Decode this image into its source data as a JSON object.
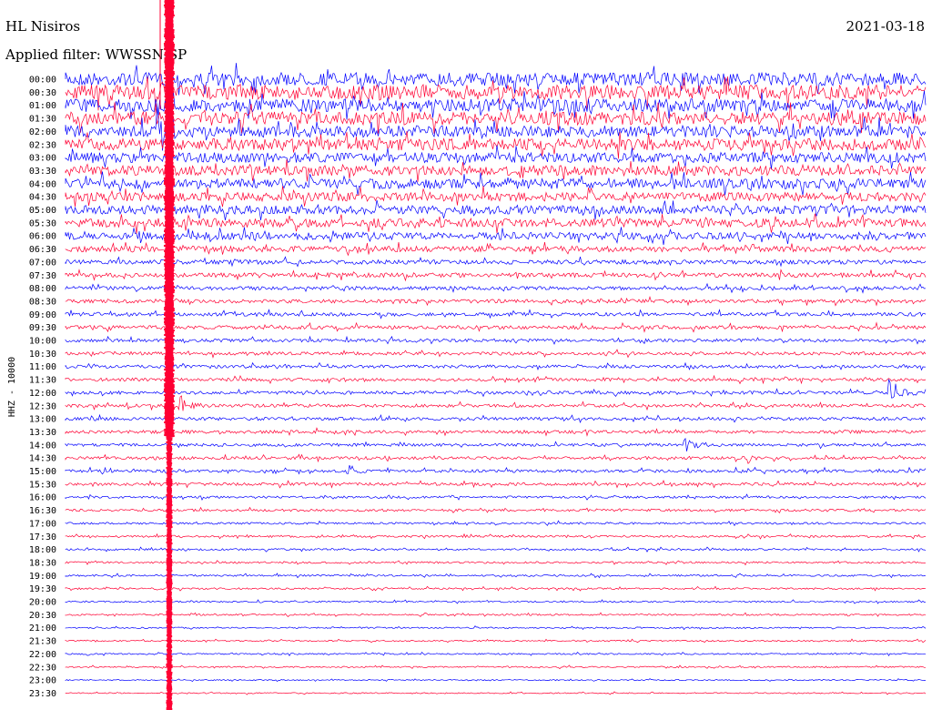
{
  "header": {
    "station": "HL Nisiros",
    "date": "2021-03-18",
    "filter": "Applied filter: WWSSN-SP"
  },
  "chart_data": {
    "type": "line",
    "title": "HL Nisiros",
    "channel_label": "HHZ - 10000",
    "colors": [
      "#0000ff",
      "#ff0033"
    ],
    "rows": [
      "00:00",
      "00:30",
      "01:00",
      "01:30",
      "02:00",
      "02:30",
      "03:00",
      "03:30",
      "04:00",
      "04:30",
      "05:00",
      "05:30",
      "06:00",
      "06:30",
      "07:00",
      "07:30",
      "08:00",
      "08:30",
      "09:00",
      "09:30",
      "10:00",
      "10:30",
      "11:00",
      "11:30",
      "12:00",
      "12:30",
      "13:00",
      "13:30",
      "14:00",
      "14:30",
      "15:00",
      "15:30",
      "16:00",
      "16:30",
      "17:00",
      "17:30",
      "18:00",
      "18:30",
      "19:00",
      "19:30",
      "20:00",
      "20:30",
      "21:00",
      "21:30",
      "22:00",
      "22:30",
      "23:00",
      "23:30"
    ],
    "noise_level": [
      9,
      10,
      9,
      9,
      8,
      8,
      7,
      7,
      7,
      6,
      6,
      6,
      5,
      4,
      3,
      3,
      2.5,
      2.5,
      2.5,
      2.5,
      2.2,
      2.2,
      2.2,
      2.2,
      2.2,
      2.2,
      2.2,
      2.2,
      2,
      2,
      2,
      2,
      1.6,
      1.6,
      1.4,
      1.4,
      1.3,
      1.3,
      1.2,
      1.2,
      1.1,
      1.1,
      1,
      1,
      1,
      1,
      0.8,
      0.8
    ],
    "events": [
      {
        "row": 4,
        "x_frac": 0.11,
        "amp": 30
      },
      {
        "row": 24,
        "x_frac": 0.96,
        "amp": 14
      },
      {
        "row": 25,
        "x_frac": 0.13,
        "amp": 12
      },
      {
        "row": 28,
        "x_frac": 0.72,
        "amp": 8
      },
      {
        "row": 29,
        "x_frac": 0.79,
        "amp": 7
      },
      {
        "row": 30,
        "x_frac": 0.33,
        "amp": 6
      }
    ]
  }
}
